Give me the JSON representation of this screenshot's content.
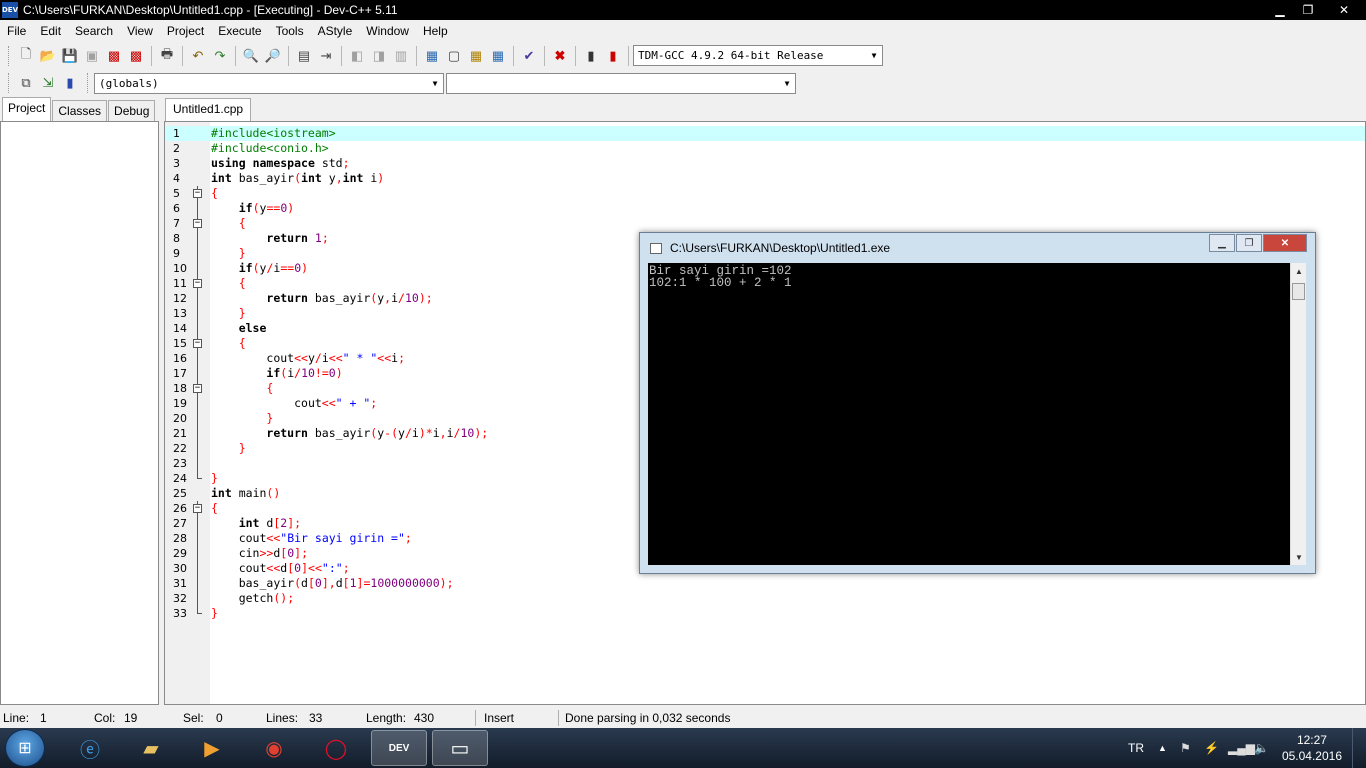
{
  "window": {
    "icon_label": "DEV",
    "title": "C:\\Users\\FURKAN\\Desktop\\Untitled1.cpp - [Executing] - Dev-C++ 5.11",
    "minimize": "▁",
    "maximize": "❐",
    "close": "✕"
  },
  "menu": [
    "File",
    "Edit",
    "Search",
    "View",
    "Project",
    "Execute",
    "Tools",
    "AStyle",
    "Window",
    "Help"
  ],
  "toolbar": {
    "compiler": "TDM-GCC 4.9.2 64-bit Release",
    "scope": "(globals)",
    "member": ""
  },
  "left_tabs": [
    "Project",
    "Classes",
    "Debug"
  ],
  "editor_tab": "Untitled1.cpp",
  "code_lines": [
    "#include<iostream>",
    "#include<conio.h>",
    "using namespace std;",
    "int bas_ayir(int y,int i)",
    "{",
    "    if(y==0)",
    "    {",
    "        return 1;",
    "    }",
    "    if(y/i==0)",
    "    {",
    "        return bas_ayir(y,i/10);",
    "    }",
    "    else",
    "    {",
    "        cout<<y/i<<\" * \"<<i;",
    "        if(i/10!=0)",
    "        {",
    "            cout<<\" + \";",
    "        }",
    "        return bas_ayir(y-(y/i)*i,i/10);",
    "    }",
    "",
    "}",
    "int main()",
    "{",
    "    int d[2];",
    "    cout<<\"Bir sayi girin =\";",
    "    cin>>d[0];",
    "    cout<<d[0]<<\":\";",
    "    bas_ayir(d[0],d[1]=1000000000);",
    "    getch();",
    "}"
  ],
  "console": {
    "title": "C:\\Users\\FURKAN\\Desktop\\Untitled1.exe",
    "output": "Bir sayi girin =102\n102:1 * 100 + 2 * 1"
  },
  "status": {
    "line_label": "Line:",
    "line_value": "1",
    "col_label": "Col:",
    "col_value": "19",
    "sel_label": "Sel:",
    "sel_value": "0",
    "lines_label": "Lines:",
    "lines_value": "33",
    "length_label": "Length:",
    "length_value": "430",
    "mode": "Insert",
    "message": "Done parsing in 0,032 seconds"
  },
  "taskbar": {
    "language": "TR",
    "time": "12:27",
    "date": "05.04.2016"
  },
  "colors": {
    "current_line": "#ccffff",
    "preprocessor": "#008000",
    "symbol": "#ff0000",
    "number": "#800080",
    "string": "#0000ff"
  }
}
